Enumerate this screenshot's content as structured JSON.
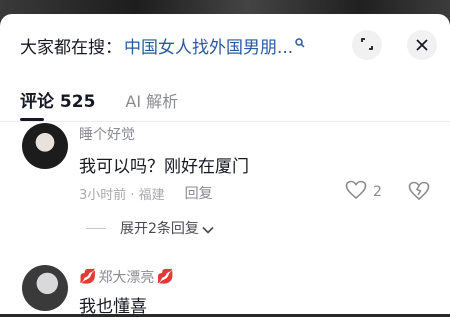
{
  "search": {
    "prefix": "大家都在搜：",
    "query": "中国女人找外国男朋..."
  },
  "tabs": {
    "comments_label": "评论 525",
    "ai_label": "AI 解析"
  },
  "comments": [
    {
      "username": "睡个好觉",
      "text": "我可以吗？刚好在厦门",
      "time_location": "3小时前 · 福建",
      "reply_label": "回复",
      "like_count": "2"
    },
    {
      "username": "郑大漂亮",
      "username_decoration": "💋",
      "text": "我也懂喜"
    }
  ],
  "expand_replies_label": "展开2条回复",
  "icons": {
    "search_mini": "search-icon",
    "expand": "expand-icon",
    "close": "close-icon",
    "like": "heart-icon",
    "dislike": "broken-heart-icon",
    "chevron": "chevron-down-icon"
  },
  "colors": {
    "query_link": "#2b5a9e",
    "muted_text": "#8a8b91",
    "lips": "#ef8aa0"
  }
}
